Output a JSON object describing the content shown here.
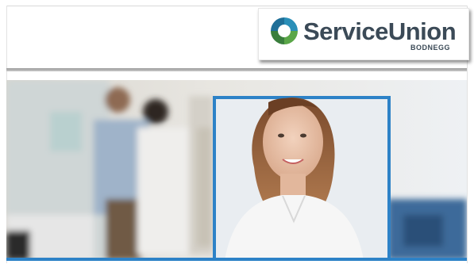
{
  "logo": {
    "brand": "ServiceUnion",
    "location": "BODNEGG"
  },
  "colors": {
    "accent_blue": "#2d82c7",
    "logo_green": "#5aa648",
    "logo_teal": "#2a8fb8",
    "text_dark": "#3b4a57"
  }
}
